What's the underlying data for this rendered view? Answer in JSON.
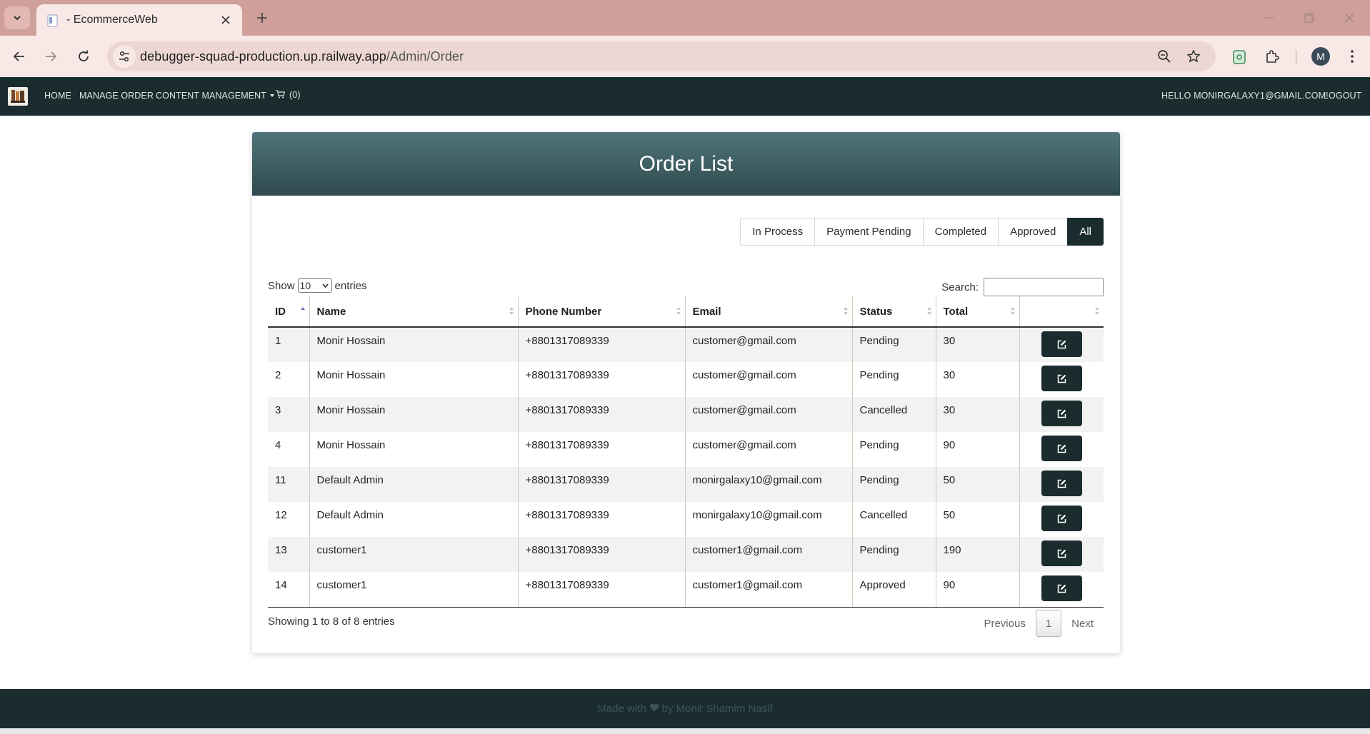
{
  "browser": {
    "tab_title": "- EcommerceWeb",
    "url_domain": "debugger-squad-production.up.railway.app",
    "url_path": "/Admin/Order",
    "profile_initial": "M"
  },
  "navbar": {
    "home": "HOME",
    "manage_order": "MANAGE ORDER",
    "content_management": "CONTENT MANAGEMENT",
    "cart_count": "(0)",
    "greeting": "HELLO MONIRGALAXY1@GMAIL.COM!",
    "logout": "LOGOUT"
  },
  "page": {
    "title": "Order List"
  },
  "filters": [
    "In Process",
    "Payment Pending",
    "Completed",
    "Approved",
    "All"
  ],
  "active_filter": "All",
  "datatable": {
    "show_label": "Show",
    "entries_label": "entries",
    "page_length": "10",
    "search_label": "Search:",
    "search_value": "",
    "columns": [
      "ID",
      "Name",
      "Phone Number",
      "Email",
      "Status",
      "Total",
      ""
    ],
    "sorted_column": "ID",
    "rows": [
      {
        "id": "1",
        "name": "Monir Hossain",
        "phone": "+8801317089339",
        "email": "customer@gmail.com",
        "status": "Pending",
        "total": "30"
      },
      {
        "id": "2",
        "name": "Monir Hossain",
        "phone": "+8801317089339",
        "email": "customer@gmail.com",
        "status": "Pending",
        "total": "30"
      },
      {
        "id": "3",
        "name": "Monir Hossain",
        "phone": "+8801317089339",
        "email": "customer@gmail.com",
        "status": "Cancelled",
        "total": "30"
      },
      {
        "id": "4",
        "name": "Monir Hossain",
        "phone": "+8801317089339",
        "email": "customer@gmail.com",
        "status": "Pending",
        "total": "90"
      },
      {
        "id": "11",
        "name": "Default Admin",
        "phone": "+8801317089339",
        "email": "monirgalaxy10@gmail.com",
        "status": "Pending",
        "total": "50"
      },
      {
        "id": "12",
        "name": "Default Admin",
        "phone": "+8801317089339",
        "email": "monirgalaxy10@gmail.com",
        "status": "Cancelled",
        "total": "50"
      },
      {
        "id": "13",
        "name": "customer1",
        "phone": "+8801317089339",
        "email": "customer1@gmail.com",
        "status": "Pending",
        "total": "190"
      },
      {
        "id": "14",
        "name": "customer1",
        "phone": "+8801317089339",
        "email": "customer1@gmail.com",
        "status": "Approved",
        "total": "90"
      }
    ],
    "info": "Showing 1 to 8 of 8 entries",
    "previous": "Previous",
    "current_page": "1",
    "next": "Next"
  },
  "footer": {
    "made_with": "Made with",
    "by": "by Monir Shamim Nasif"
  },
  "colors": {
    "navbar_bg": "#1b2c2f",
    "header_gradient_top": "#4f7479",
    "header_gradient_bottom": "#2f4a4e",
    "tabstrip_bg": "#cfa09a"
  }
}
